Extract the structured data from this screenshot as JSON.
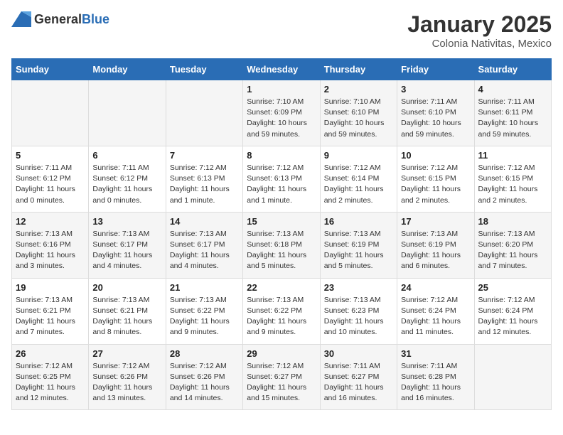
{
  "logo": {
    "general": "General",
    "blue": "Blue"
  },
  "title": "January 2025",
  "subtitle": "Colonia Nativitas, Mexico",
  "days_of_week": [
    "Sunday",
    "Monday",
    "Tuesday",
    "Wednesday",
    "Thursday",
    "Friday",
    "Saturday"
  ],
  "weeks": [
    [
      {
        "day": "",
        "info": ""
      },
      {
        "day": "",
        "info": ""
      },
      {
        "day": "",
        "info": ""
      },
      {
        "day": "1",
        "info": "Sunrise: 7:10 AM\nSunset: 6:09 PM\nDaylight: 10 hours and 59 minutes."
      },
      {
        "day": "2",
        "info": "Sunrise: 7:10 AM\nSunset: 6:10 PM\nDaylight: 10 hours and 59 minutes."
      },
      {
        "day": "3",
        "info": "Sunrise: 7:11 AM\nSunset: 6:10 PM\nDaylight: 10 hours and 59 minutes."
      },
      {
        "day": "4",
        "info": "Sunrise: 7:11 AM\nSunset: 6:11 PM\nDaylight: 10 hours and 59 minutes."
      }
    ],
    [
      {
        "day": "5",
        "info": "Sunrise: 7:11 AM\nSunset: 6:12 PM\nDaylight: 11 hours and 0 minutes."
      },
      {
        "day": "6",
        "info": "Sunrise: 7:11 AM\nSunset: 6:12 PM\nDaylight: 11 hours and 0 minutes."
      },
      {
        "day": "7",
        "info": "Sunrise: 7:12 AM\nSunset: 6:13 PM\nDaylight: 11 hours and 1 minute."
      },
      {
        "day": "8",
        "info": "Sunrise: 7:12 AM\nSunset: 6:13 PM\nDaylight: 11 hours and 1 minute."
      },
      {
        "day": "9",
        "info": "Sunrise: 7:12 AM\nSunset: 6:14 PM\nDaylight: 11 hours and 2 minutes."
      },
      {
        "day": "10",
        "info": "Sunrise: 7:12 AM\nSunset: 6:15 PM\nDaylight: 11 hours and 2 minutes."
      },
      {
        "day": "11",
        "info": "Sunrise: 7:12 AM\nSunset: 6:15 PM\nDaylight: 11 hours and 2 minutes."
      }
    ],
    [
      {
        "day": "12",
        "info": "Sunrise: 7:13 AM\nSunset: 6:16 PM\nDaylight: 11 hours and 3 minutes."
      },
      {
        "day": "13",
        "info": "Sunrise: 7:13 AM\nSunset: 6:17 PM\nDaylight: 11 hours and 4 minutes."
      },
      {
        "day": "14",
        "info": "Sunrise: 7:13 AM\nSunset: 6:17 PM\nDaylight: 11 hours and 4 minutes."
      },
      {
        "day": "15",
        "info": "Sunrise: 7:13 AM\nSunset: 6:18 PM\nDaylight: 11 hours and 5 minutes."
      },
      {
        "day": "16",
        "info": "Sunrise: 7:13 AM\nSunset: 6:19 PM\nDaylight: 11 hours and 5 minutes."
      },
      {
        "day": "17",
        "info": "Sunrise: 7:13 AM\nSunset: 6:19 PM\nDaylight: 11 hours and 6 minutes."
      },
      {
        "day": "18",
        "info": "Sunrise: 7:13 AM\nSunset: 6:20 PM\nDaylight: 11 hours and 7 minutes."
      }
    ],
    [
      {
        "day": "19",
        "info": "Sunrise: 7:13 AM\nSunset: 6:21 PM\nDaylight: 11 hours and 7 minutes."
      },
      {
        "day": "20",
        "info": "Sunrise: 7:13 AM\nSunset: 6:21 PM\nDaylight: 11 hours and 8 minutes."
      },
      {
        "day": "21",
        "info": "Sunrise: 7:13 AM\nSunset: 6:22 PM\nDaylight: 11 hours and 9 minutes."
      },
      {
        "day": "22",
        "info": "Sunrise: 7:13 AM\nSunset: 6:22 PM\nDaylight: 11 hours and 9 minutes."
      },
      {
        "day": "23",
        "info": "Sunrise: 7:13 AM\nSunset: 6:23 PM\nDaylight: 11 hours and 10 minutes."
      },
      {
        "day": "24",
        "info": "Sunrise: 7:12 AM\nSunset: 6:24 PM\nDaylight: 11 hours and 11 minutes."
      },
      {
        "day": "25",
        "info": "Sunrise: 7:12 AM\nSunset: 6:24 PM\nDaylight: 11 hours and 12 minutes."
      }
    ],
    [
      {
        "day": "26",
        "info": "Sunrise: 7:12 AM\nSunset: 6:25 PM\nDaylight: 11 hours and 12 minutes."
      },
      {
        "day": "27",
        "info": "Sunrise: 7:12 AM\nSunset: 6:26 PM\nDaylight: 11 hours and 13 minutes."
      },
      {
        "day": "28",
        "info": "Sunrise: 7:12 AM\nSunset: 6:26 PM\nDaylight: 11 hours and 14 minutes."
      },
      {
        "day": "29",
        "info": "Sunrise: 7:12 AM\nSunset: 6:27 PM\nDaylight: 11 hours and 15 minutes."
      },
      {
        "day": "30",
        "info": "Sunrise: 7:11 AM\nSunset: 6:27 PM\nDaylight: 11 hours and 16 minutes."
      },
      {
        "day": "31",
        "info": "Sunrise: 7:11 AM\nSunset: 6:28 PM\nDaylight: 11 hours and 16 minutes."
      },
      {
        "day": "",
        "info": ""
      }
    ]
  ]
}
